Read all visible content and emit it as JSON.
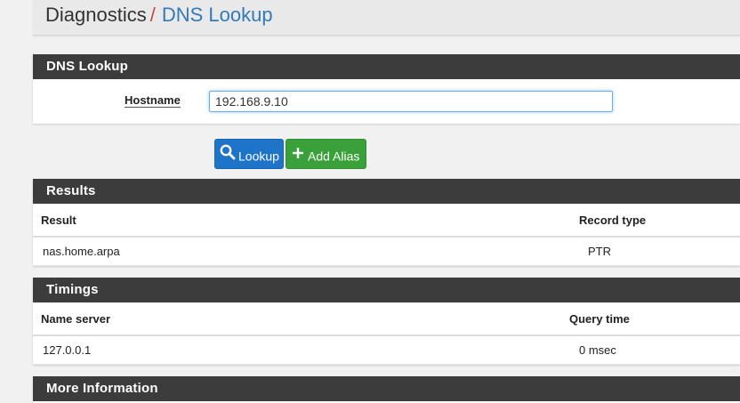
{
  "breadcrumb": {
    "section": "Diagnostics",
    "separator": "/",
    "current": "DNS Lookup"
  },
  "lookup_panel": {
    "title": "DNS Lookup",
    "hostname_label": "Hostname",
    "hostname_value": "192.168.9.10"
  },
  "buttons": {
    "lookup": "Lookup",
    "add_alias": "Add Alias"
  },
  "results": {
    "title": "Results",
    "columns": [
      "Result",
      "Record type"
    ],
    "rows": [
      [
        "nas.home.arpa",
        "PTR"
      ]
    ]
  },
  "timings": {
    "title": "Timings",
    "columns": [
      "Name server",
      "Query time"
    ],
    "rows": [
      [
        "127.0.0.1",
        "0 msec"
      ]
    ]
  },
  "more_info": {
    "title": "More Information"
  },
  "colors": {
    "panel_heading": "#3c3c3c",
    "primary": "#1e74c9",
    "success": "#3aa03a",
    "breadcrumb_link": "#337ab7",
    "breadcrumb_separator": "#b94a48"
  },
  "icons": {
    "lookup": "search-icon",
    "add_alias": "plus-icon"
  }
}
